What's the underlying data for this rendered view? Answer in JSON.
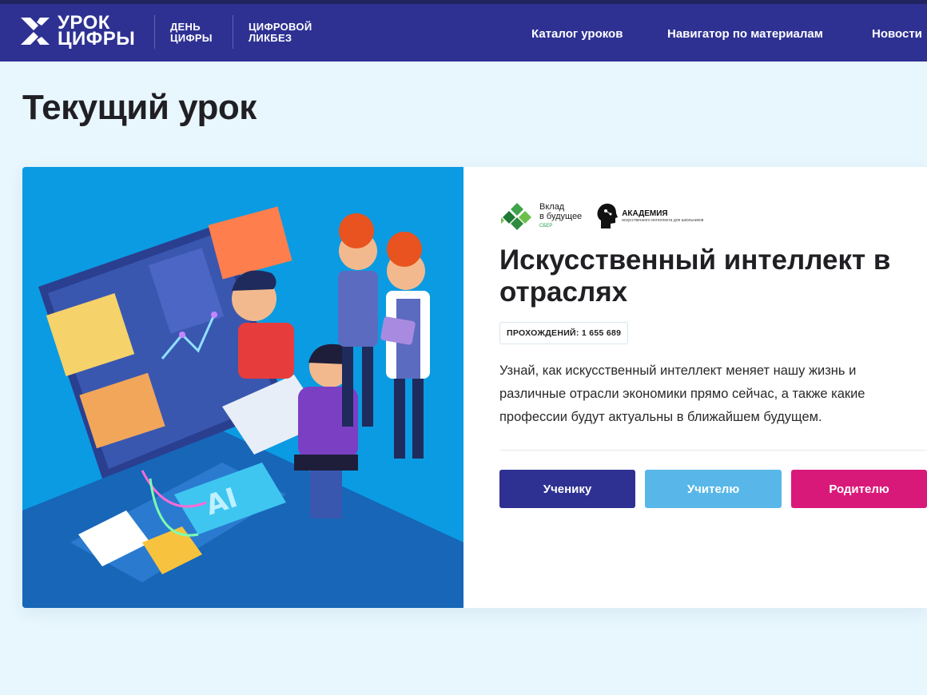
{
  "header": {
    "logo_line1": "УРОК",
    "logo_line2": "ЦИФРЫ",
    "subbrand1_line1": "ДЕНЬ",
    "subbrand1_line2": "ЦИФРЫ",
    "subbrand2_line1": "ЦИФРОВОЙ",
    "subbrand2_line2": "ЛИКБЕЗ",
    "nav": [
      "Каталог уроков",
      "Навигатор по материалам",
      "Новости"
    ]
  },
  "page": {
    "title": "Текущий урок"
  },
  "lesson": {
    "partner1_line1": "Вклад",
    "partner1_line2": "в будущее",
    "partner1_sub": "СБЕР",
    "partner2_name": "АКАДЕМИЯ",
    "partner2_sub": "искусственного интеллекта для школьников",
    "title": "Искусственный интеллект в отраслях",
    "counter": "ПРОХОЖДЕНИЙ: 1 655 689",
    "description": "Узнай, как искусственный интеллект меняет нашу жизнь и различные отрасли экономики прямо сейчас, а также какие профессии будут актуальны в ближайшем будущем.",
    "illustration_label": "AI",
    "buttons": {
      "student": "Ученику",
      "teacher": "Учителю",
      "parent": "Родителю"
    }
  },
  "colors": {
    "header": "#2e3192",
    "page_bg": "#e8f6fd",
    "student_btn": "#2e3192",
    "teacher_btn": "#58b7e8",
    "parent_btn": "#d9197a",
    "illustration_bg": "#0b9be2"
  }
}
